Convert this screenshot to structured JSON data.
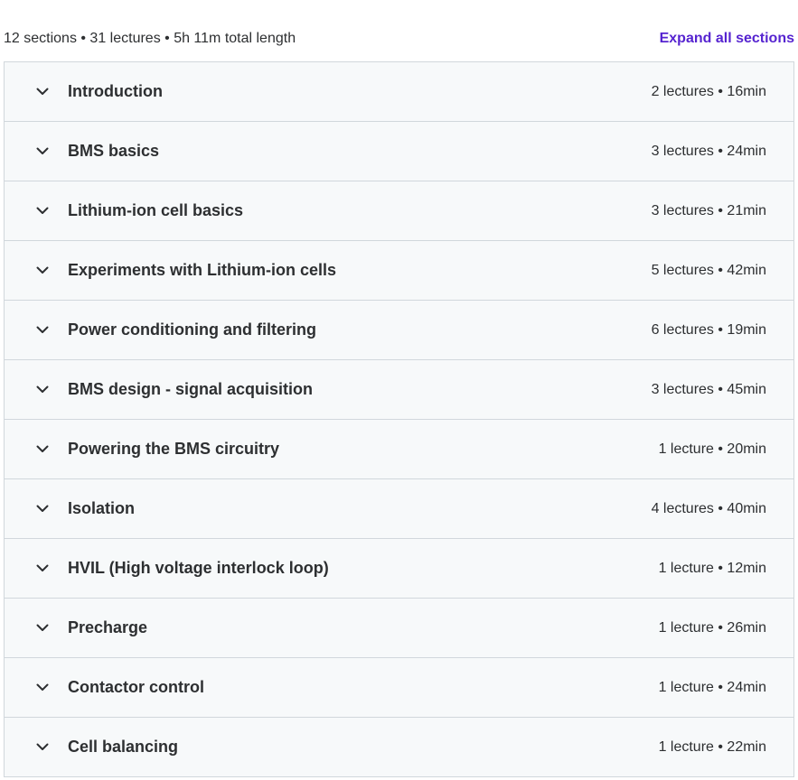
{
  "curriculum": {
    "summary": "12 sections • 31 lectures • 5h 11m total length",
    "expand_all_label": "Expand all sections",
    "sections": [
      {
        "title": "Introduction",
        "meta": "2 lectures • 16min",
        "icon": "chevron-down-icon"
      },
      {
        "title": "BMS basics",
        "meta": "3 lectures • 24min",
        "icon": "chevron-down-icon"
      },
      {
        "title": "Lithium-ion cell basics",
        "meta": "3 lectures • 21min",
        "icon": "chevron-down-icon"
      },
      {
        "title": "Experiments with Lithium-ion cells",
        "meta": "5 lectures • 42min",
        "icon": "chevron-down-icon"
      },
      {
        "title": "Power conditioning and filtering",
        "meta": "6 lectures • 19min",
        "icon": "chevron-down-icon"
      },
      {
        "title": "BMS design - signal acquisition",
        "meta": "3 lectures • 45min",
        "icon": "chevron-down-icon"
      },
      {
        "title": "Powering the BMS circuitry",
        "meta": "1 lecture • 20min",
        "icon": "chevron-down-icon"
      },
      {
        "title": "Isolation",
        "meta": "4 lectures • 40min",
        "icon": "chevron-down-icon"
      },
      {
        "title": "HVIL (High voltage interlock loop)",
        "meta": "1 lecture • 12min",
        "icon": "chevron-down-icon"
      },
      {
        "title": "Precharge",
        "meta": "1 lecture • 26min",
        "icon": "chevron-down-icon"
      },
      {
        "title": "Contactor control",
        "meta": "1 lecture • 24min",
        "icon": "chevron-down-icon"
      },
      {
        "title": "Cell balancing",
        "meta": "1 lecture • 22min",
        "icon": "chevron-down-icon"
      }
    ]
  },
  "colors": {
    "link": "#5624d0",
    "text": "#2d2f31",
    "row_background": "#f7f9fa",
    "border": "#d1d7dc"
  }
}
